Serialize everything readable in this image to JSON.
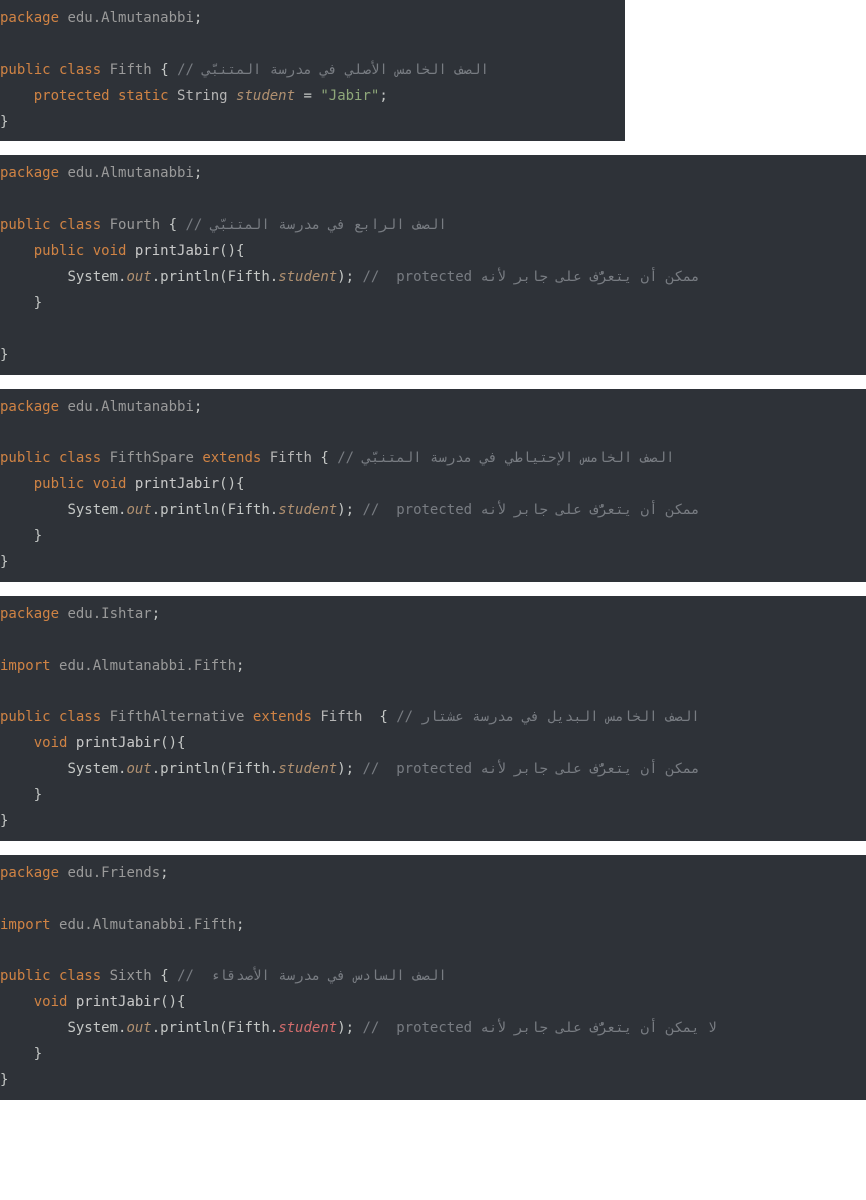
{
  "blocks": [
    {
      "package_kw": "package",
      "package_name": "edu.Almutanabbi",
      "class_kw": "public class",
      "class_name": "Fifth",
      "class_comment": "// الصف الخامس الأصلي في مدرسة المتنبّي",
      "field_line": {
        "mods": "protected static",
        "type": "String",
        "name": "student",
        "assign": " = ",
        "value": "\"Jabir\"",
        "semi": ";"
      }
    },
    {
      "package_kw": "package",
      "package_name": "edu.Almutanabbi",
      "class_kw": "public class",
      "class_name": "Fourth",
      "class_comment": "// الصف الرابع في مدرسة المتنبّي",
      "method": {
        "mods": "public void",
        "name": "printJabir",
        "body_prefix": "System.",
        "out": "out",
        "println": ".println(Fifth.",
        "student": "student",
        "close": "); ",
        "comment": "//  protected ممكن أن يتعرُّف على جابر لأنه"
      }
    },
    {
      "package_kw": "package",
      "package_name": "edu.Almutanabbi",
      "class_kw": "public class",
      "class_name": "FifthSpare",
      "extends_kw": "extends",
      "super_name": "Fifth",
      "class_comment": "// الصف الخامس الإحتياطي في مدرسة المتنبّي",
      "method": {
        "mods": "public void",
        "name": "printJabir",
        "body_prefix": "System.",
        "out": "out",
        "println": ".println(Fifth.",
        "student": "student",
        "close": "); ",
        "comment": "//  protected ممكن أن يتعرُّف على جابر لأنه"
      }
    },
    {
      "package_kw": "package",
      "package_name": "edu.Ishtar",
      "import_kw": "import",
      "import_name": "edu.Almutanabbi.Fifth",
      "class_kw": "public class",
      "class_name": "FifthAlternative",
      "extends_kw": "extends",
      "super_name": "Fifth",
      "class_comment": "// الصف الخامس البديل في مدرسة عشتار",
      "method": {
        "mods": "void",
        "name": "printJabir",
        "body_prefix": "System.",
        "out": "out",
        "println": ".println(Fifth.",
        "student": "student",
        "close": "); ",
        "comment": "//  protected ممكن أن يتعرُّف على جابر لأنه"
      }
    },
    {
      "package_kw": "package",
      "package_name": "edu.Friends",
      "import_kw": "import",
      "import_name": "edu.Almutanabbi.Fifth",
      "class_kw": "public class",
      "class_name": "Sixth",
      "class_comment": "//  الصف السادس في مدرسة الأصدقاء",
      "method": {
        "mods": "void",
        "name": "printJabir",
        "body_prefix": "System.",
        "out": "out",
        "println": ".println(Fifth.",
        "student_err": "student",
        "close": "); ",
        "comment": "//  protected لا يمكن أن يتعرُّف على جابر لأنه"
      }
    }
  ]
}
